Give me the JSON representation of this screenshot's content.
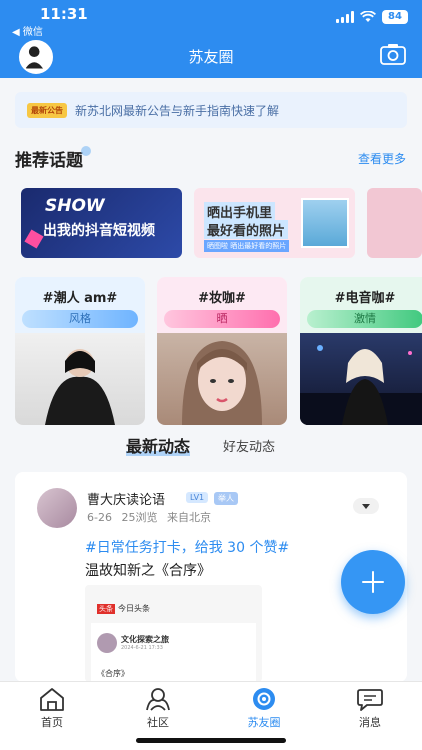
{
  "status_bar": {
    "time": "11:31",
    "back_app": "◀ 微信",
    "battery": "84"
  },
  "header": {
    "title": "苏友圈"
  },
  "notice": {
    "badge": "最新公告",
    "text": "新苏北网最新公告与新手指南快速了解"
  },
  "recommended": {
    "title": "推荐话题",
    "see_more": "查看更多",
    "banners": [
      {
        "line1": "SHOW",
        "line2": "出我的抖音短视频"
      },
      {
        "line1": "晒出手机里",
        "line2": "最好看的照片",
        "tag": "晒图啦  晒出最好看的照片"
      }
    ],
    "topics": [
      {
        "name": "#潮人 am#",
        "tag": "风格"
      },
      {
        "name": "#妆咖#",
        "tag": "晒"
      },
      {
        "name": "#电音咖#",
        "tag": "激情"
      }
    ]
  },
  "feed_tabs": {
    "latest": "最新动态",
    "friends": "好友动态"
  },
  "post": {
    "author": "曹大庆读论语",
    "level": "LV1",
    "role": "举人",
    "date": "6-26",
    "views": "25浏览",
    "location": "来自北京",
    "topic": "#日常任务打卡，给我 30 个赞#",
    "text": "温故知新之《合序》",
    "share": {
      "source_tag": "头条",
      "source": "今日头条",
      "author": "文化探索之旅",
      "date": "2024-6-21 17:33",
      "title": "《合序》"
    }
  },
  "bottom_nav": [
    {
      "label": "首页"
    },
    {
      "label": "社区"
    },
    {
      "label": "苏友圈"
    },
    {
      "label": "消息"
    }
  ],
  "colors": {
    "primary": "#2d8cf0",
    "fab": "#3596f4"
  }
}
